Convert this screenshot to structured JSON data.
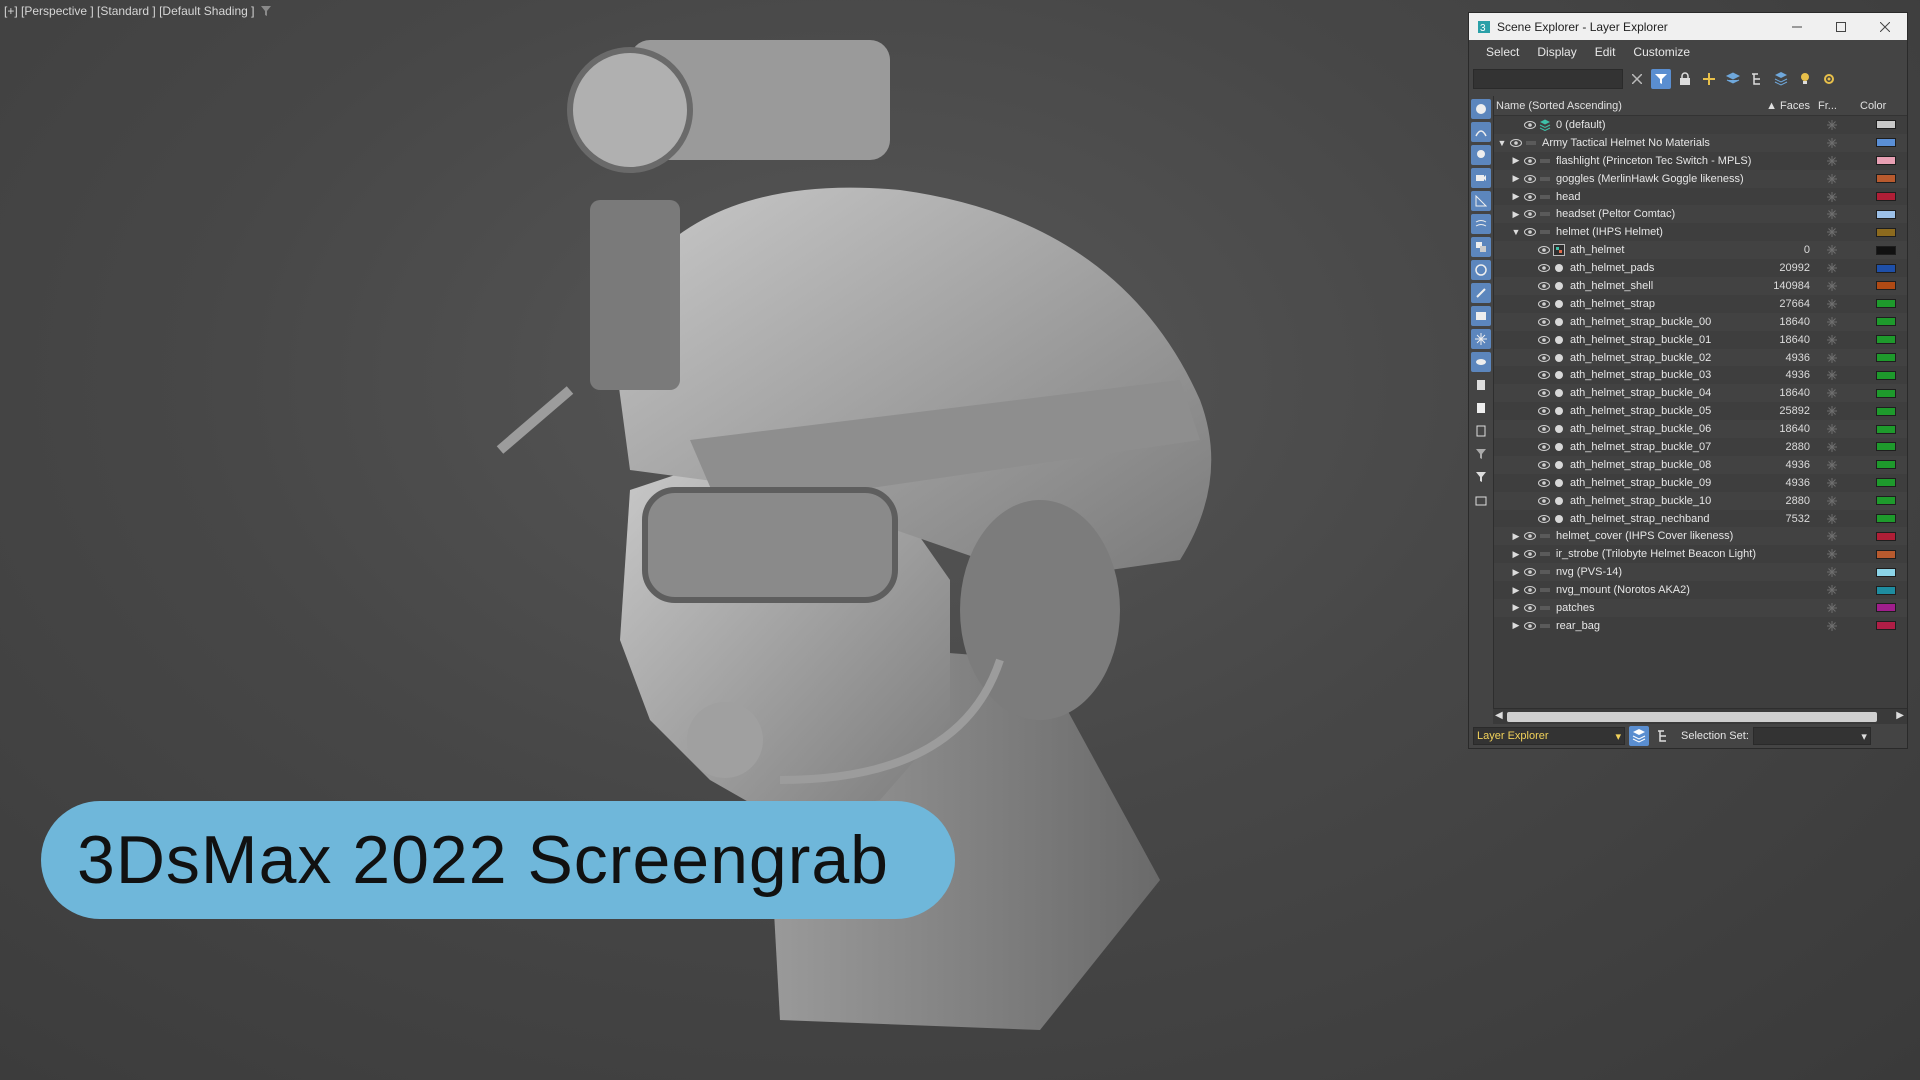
{
  "viewport": {
    "label": "[+] [Perspective ] [Standard ] [Default Shading ]",
    "filter_icon": "funnel-icon"
  },
  "caption": "3DsMax 2022 Screengrab",
  "scene_explorer": {
    "title": "Scene Explorer - Layer Explorer",
    "window_buttons": [
      "minimize",
      "maximize",
      "close"
    ],
    "menu": [
      "Select",
      "Display",
      "Edit",
      "Customize"
    ],
    "search_placeholder": "",
    "columns": {
      "name": "Name (Sorted Ascending)",
      "faces": "▲ Faces",
      "frozen": "Fr...",
      "color": "Color"
    },
    "rows": [
      {
        "level": 1,
        "arrow": "",
        "icon": "layer-stack",
        "name": "0 (default)",
        "faces": "",
        "color": "#c8c8c8"
      },
      {
        "level": 0,
        "arrow": "down",
        "icon": "layer",
        "name": "Army Tactical Helmet No Materials",
        "faces": "",
        "color": "#5a8fd6"
      },
      {
        "level": 1,
        "arrow": "right",
        "icon": "layer",
        "name": "flashlight (Princeton Tec Switch - MPLS)",
        "faces": "",
        "color": "#e8a0b4"
      },
      {
        "level": 1,
        "arrow": "right",
        "icon": "layer",
        "name": "goggles (MerlinHawk Goggle likeness)",
        "faces": "",
        "color": "#b85a2e"
      },
      {
        "level": 1,
        "arrow": "right",
        "icon": "layer",
        "name": "head",
        "faces": "",
        "color": "#b01e36"
      },
      {
        "level": 1,
        "arrow": "right",
        "icon": "layer",
        "name": "headset (Peltor Comtac)",
        "faces": "",
        "color": "#9cc0e8"
      },
      {
        "level": 1,
        "arrow": "down",
        "icon": "layer",
        "name": "helmet (IHPS Helmet)",
        "faces": "",
        "color": "#8c6a1e"
      },
      {
        "level": 2,
        "arrow": "",
        "icon": "group",
        "name": "ath_helmet",
        "faces": "0",
        "color": "#111111"
      },
      {
        "level": 2,
        "arrow": "",
        "icon": "object",
        "name": "ath_helmet_pads",
        "faces": "20992",
        "color": "#1e4fa8"
      },
      {
        "level": 2,
        "arrow": "",
        "icon": "object",
        "name": "ath_helmet_shell",
        "faces": "140984",
        "color": "#b04a14"
      },
      {
        "level": 2,
        "arrow": "",
        "icon": "object",
        "name": "ath_helmet_strap",
        "faces": "27664",
        "color": "#1e9a2c"
      },
      {
        "level": 2,
        "arrow": "",
        "icon": "object",
        "name": "ath_helmet_strap_buckle_00",
        "faces": "18640",
        "color": "#1e9a2c"
      },
      {
        "level": 2,
        "arrow": "",
        "icon": "object",
        "name": "ath_helmet_strap_buckle_01",
        "faces": "18640",
        "color": "#1e9a2c"
      },
      {
        "level": 2,
        "arrow": "",
        "icon": "object",
        "name": "ath_helmet_strap_buckle_02",
        "faces": "4936",
        "color": "#1e9a2c"
      },
      {
        "level": 2,
        "arrow": "",
        "icon": "object",
        "name": "ath_helmet_strap_buckle_03",
        "faces": "4936",
        "color": "#1e9a2c"
      },
      {
        "level": 2,
        "arrow": "",
        "icon": "object",
        "name": "ath_helmet_strap_buckle_04",
        "faces": "18640",
        "color": "#1e9a2c"
      },
      {
        "level": 2,
        "arrow": "",
        "icon": "object",
        "name": "ath_helmet_strap_buckle_05",
        "faces": "25892",
        "color": "#1e9a2c"
      },
      {
        "level": 2,
        "arrow": "",
        "icon": "object",
        "name": "ath_helmet_strap_buckle_06",
        "faces": "18640",
        "color": "#1e9a2c"
      },
      {
        "level": 2,
        "arrow": "",
        "icon": "object",
        "name": "ath_helmet_strap_buckle_07",
        "faces": "2880",
        "color": "#1e9a2c"
      },
      {
        "level": 2,
        "arrow": "",
        "icon": "object",
        "name": "ath_helmet_strap_buckle_08",
        "faces": "4936",
        "color": "#1e9a2c"
      },
      {
        "level": 2,
        "arrow": "",
        "icon": "object",
        "name": "ath_helmet_strap_buckle_09",
        "faces": "4936",
        "color": "#1e9a2c"
      },
      {
        "level": 2,
        "arrow": "",
        "icon": "object",
        "name": "ath_helmet_strap_buckle_10",
        "faces": "2880",
        "color": "#1e9a2c"
      },
      {
        "level": 2,
        "arrow": "",
        "icon": "object",
        "name": "ath_helmet_strap_nechband",
        "faces": "7532",
        "color": "#1e9a2c"
      },
      {
        "level": 1,
        "arrow": "right",
        "icon": "layer",
        "name": "helmet_cover (IHPS Cover likeness)",
        "faces": "",
        "color": "#b01e36"
      },
      {
        "level": 1,
        "arrow": "right",
        "icon": "layer",
        "name": "ir_strobe (Trilobyte Helmet Beacon Light)",
        "faces": "",
        "color": "#b85a2e"
      },
      {
        "level": 1,
        "arrow": "right",
        "icon": "layer",
        "name": "nvg (PVS-14)",
        "faces": "",
        "color": "#8cd4e8"
      },
      {
        "level": 1,
        "arrow": "right",
        "icon": "layer",
        "name": "nvg_mount (Norotos AKA2)",
        "faces": "",
        "color": "#1e8ca0"
      },
      {
        "level": 1,
        "arrow": "right",
        "icon": "layer",
        "name": "patches",
        "faces": "",
        "color": "#a01e8c"
      },
      {
        "level": 1,
        "arrow": "right",
        "icon": "layer",
        "name": "rear_bag",
        "faces": "",
        "color": "#b01e46"
      }
    ],
    "bottom": {
      "explorer_select": "Layer Explorer",
      "selection_set_label": "Selection Set:",
      "selection_set_value": ""
    }
  }
}
